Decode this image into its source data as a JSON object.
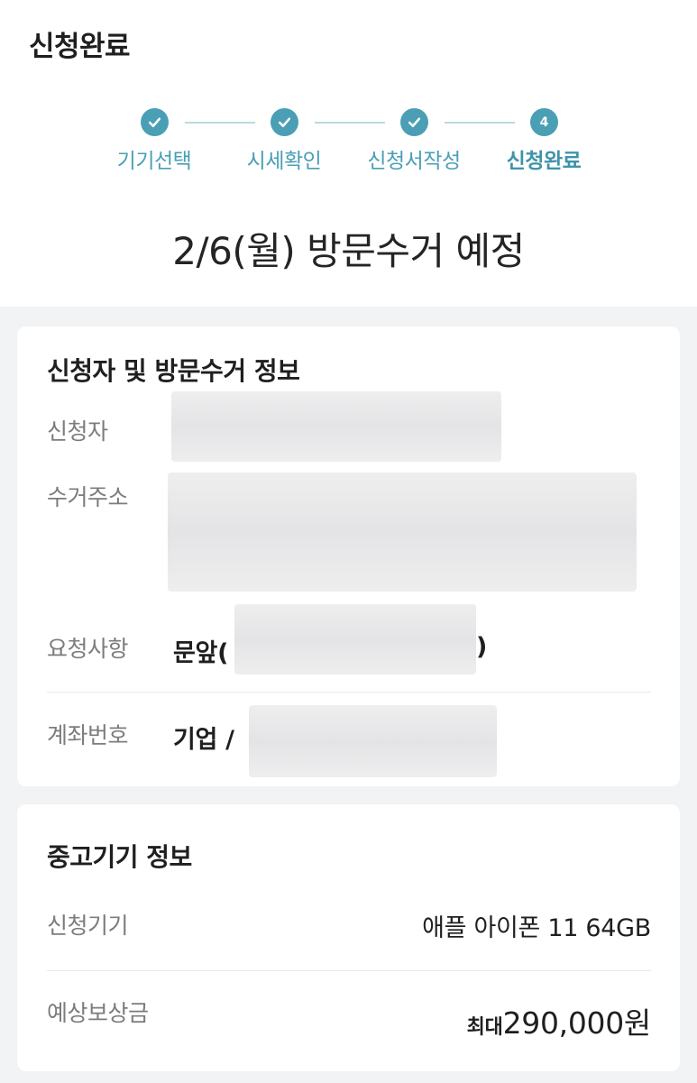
{
  "header": {
    "title": "신청완료"
  },
  "steps": [
    {
      "label": "기기선택",
      "state": "done"
    },
    {
      "label": "시세확인",
      "state": "done"
    },
    {
      "label": "신청서작성",
      "state": "done"
    },
    {
      "label": "신청완료",
      "state": "current",
      "number": "4"
    }
  ],
  "visit": {
    "title": "2/6(월) 방문수거 예정"
  },
  "applicant_card": {
    "title": "신청자 및 방문수거 정보",
    "applicant_label": "신청자",
    "address_label": "수거주소",
    "request_label": "요청사항",
    "request_prefix": "문앞(",
    "request_suffix": ")",
    "account_label": "계좌번호",
    "account_value": "기업 /"
  },
  "device_card": {
    "title": "중고기기 정보",
    "device_label": "신청기기",
    "device_value": "애플 아이폰 11 64GB",
    "price_label": "예상보상금",
    "price_prefix": "최대",
    "price_value": "290,000원"
  },
  "colors": {
    "accent": "#4a9fb5",
    "line": "#bcd9e0",
    "background": "#f2f3f5"
  }
}
